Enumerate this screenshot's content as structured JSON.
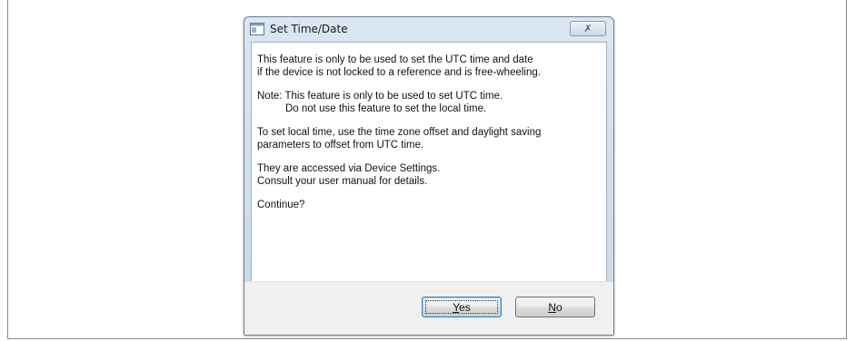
{
  "dialog": {
    "title": "Set Time/Date",
    "close_glyph": "✗",
    "icon": "app-window-icon"
  },
  "message": {
    "p1": [
      "This feature is only to be used to set the UTC time and date",
      "if the device is not locked to a reference and is free-wheeling."
    ],
    "p2": [
      "Note: This feature is only to be used to set UTC time.",
      "Do not use this feature to set the local time."
    ],
    "p3": [
      "To set local time, use the time zone offset and daylight saving",
      "parameters to offset from UTC time."
    ],
    "p4": [
      "They are accessed via Device Settings.",
      "Consult your user manual for details."
    ],
    "p5": "Continue?"
  },
  "buttons": {
    "yes": {
      "mnemonic": "Y",
      "rest": "es"
    },
    "no": {
      "mnemonic": "N",
      "rest": "o"
    }
  },
  "colors": {
    "titlebar": "#dbe6f1",
    "footer": "#f0f0f0",
    "default_button_border": "#3c7fb1"
  }
}
